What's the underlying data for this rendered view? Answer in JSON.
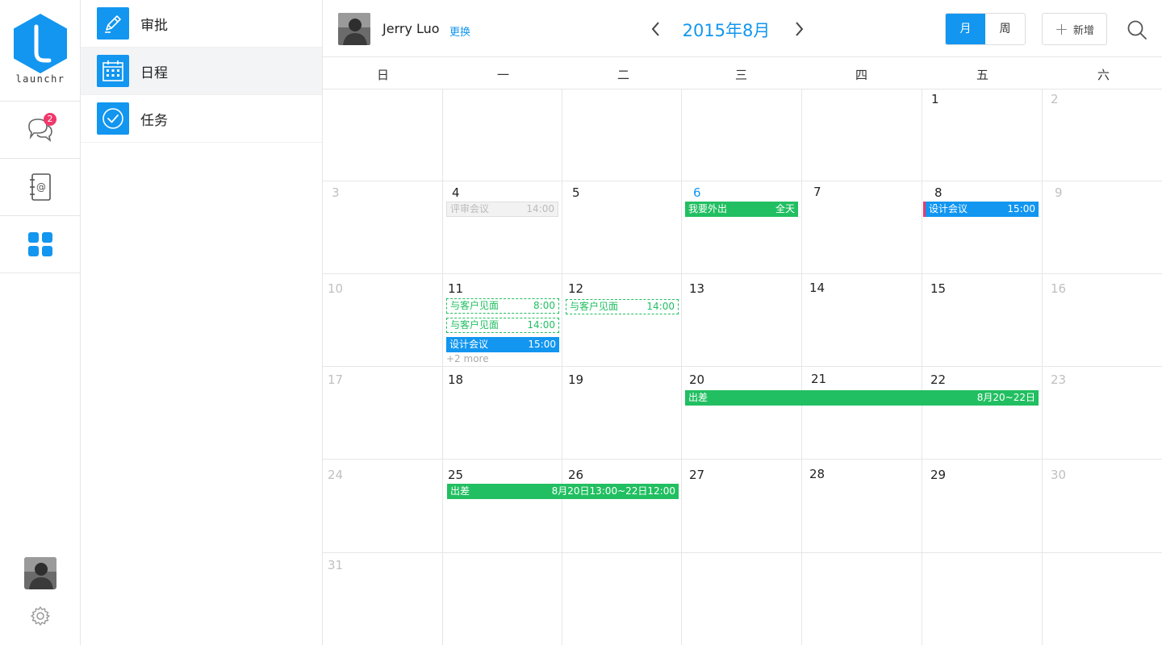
{
  "app": {
    "logo_text": "launchr",
    "unread_count": "2"
  },
  "sidebar": {
    "items": [
      {
        "label": "审批"
      },
      {
        "label": "日程"
      },
      {
        "label": "任务"
      }
    ]
  },
  "header": {
    "user_name": "Jerry Luo",
    "switch_label": "更换",
    "month_title": "2015年8月",
    "view_month": "月",
    "view_week": "周",
    "add_label": "新增"
  },
  "calendar": {
    "weekdays": [
      "日",
      "一",
      "二",
      "三",
      "四",
      "五",
      "六"
    ],
    "weeks": [
      [
        "",
        "",
        "",
        "",
        "",
        "1",
        "2"
      ],
      [
        "3",
        "4",
        "5",
        "6",
        "7",
        "8",
        "9"
      ],
      [
        "10",
        "11",
        "12",
        "13",
        "14",
        "15",
        "16"
      ],
      [
        "17",
        "18",
        "19",
        "20",
        "21",
        "22",
        "23"
      ],
      [
        "24",
        "25",
        "26",
        "27",
        "28",
        "29",
        "30"
      ],
      [
        "31",
        "",
        "",
        "",
        "",
        "",
        ""
      ]
    ],
    "events": [
      {
        "title": "评审会议",
        "time": "14:00",
        "style": "past"
      },
      {
        "title": "我要外出",
        "time": "全天",
        "style": "green"
      },
      {
        "title": "设计会议",
        "time": "15:00",
        "style": "blue-marked"
      },
      {
        "title": "与客户见面",
        "time": "8:00",
        "style": "dashed"
      },
      {
        "title": "与客户见面",
        "time": "14:00",
        "style": "dashed"
      },
      {
        "title": "设计会议",
        "time": "15:00",
        "style": "blue"
      },
      {
        "title": "与客户见面",
        "time": "14:00",
        "style": "dashed"
      },
      {
        "title": "出差",
        "time": "8月20~22日",
        "style": "green"
      },
      {
        "title": "出差",
        "time": "8月20日13:00~22日12:00",
        "style": "green"
      }
    ],
    "more_label": "+2 more"
  },
  "colors": {
    "accent": "#1296f0",
    "green": "#21bf61",
    "badge": "#f0386b"
  }
}
